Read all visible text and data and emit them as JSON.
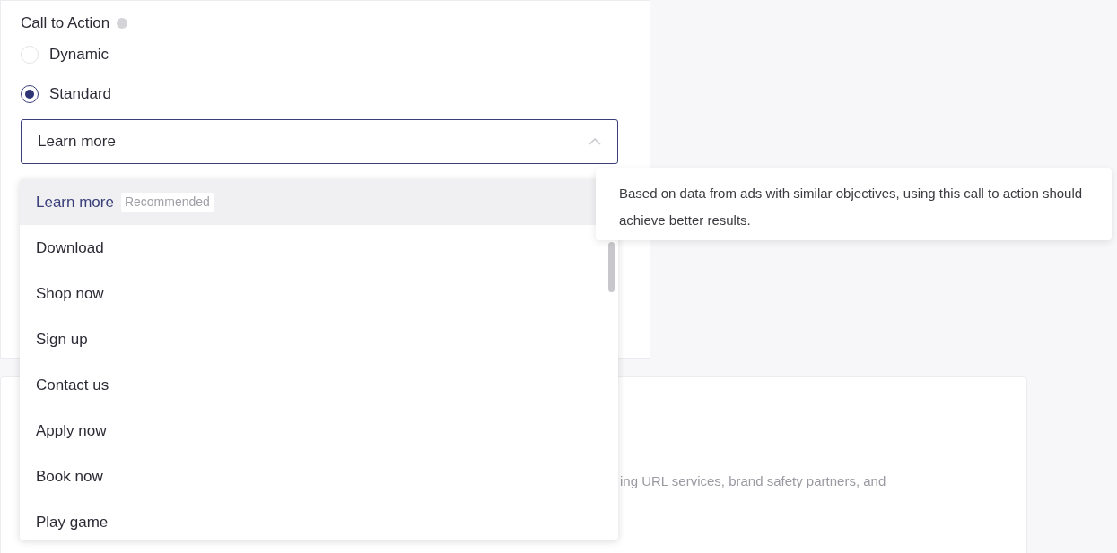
{
  "field": {
    "label": "Call to Action"
  },
  "options": [
    {
      "label": "Dynamic",
      "selected": false
    },
    {
      "label": "Standard",
      "selected": true
    }
  ],
  "select": {
    "value": "Learn more",
    "expanded": true
  },
  "menu": [
    {
      "label": "Learn more",
      "badge": "Recommended",
      "selected": true
    },
    {
      "label": "Download",
      "selected": false
    },
    {
      "label": "Shop now",
      "selected": false
    },
    {
      "label": "Sign up",
      "selected": false
    },
    {
      "label": "Contact us",
      "selected": false
    },
    {
      "label": "Apply now",
      "selected": false
    },
    {
      "label": "Book now",
      "selected": false
    },
    {
      "label": "Play game",
      "selected": false
    }
  ],
  "tooltip": "Based on data from ads with similar objectives, using this call to action should achieve better results.",
  "card_text": "ing URL services, brand safety partners, and"
}
